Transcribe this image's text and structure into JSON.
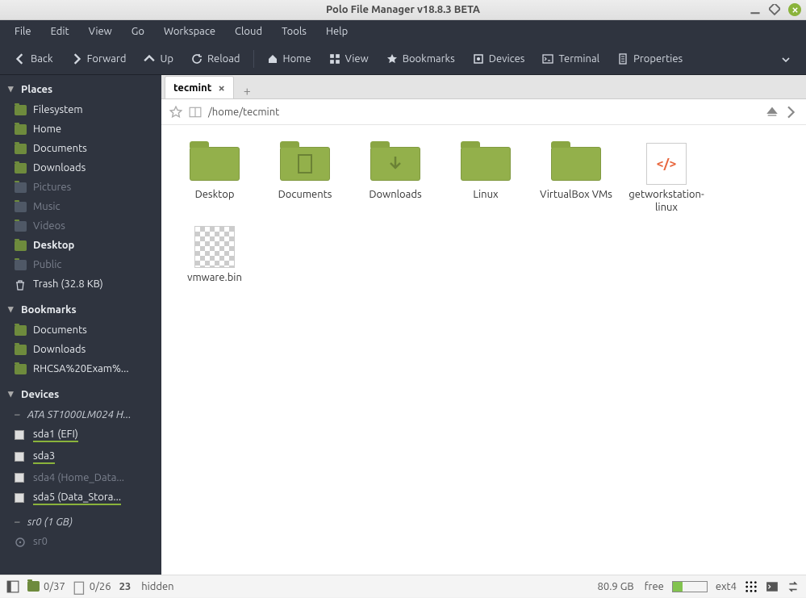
{
  "window": {
    "title": "Polo File Manager v18.8.3 BETA"
  },
  "menubar": [
    "File",
    "Edit",
    "View",
    "Go",
    "Workspace",
    "Cloud",
    "Tools",
    "Help"
  ],
  "toolbar": {
    "back": "Back",
    "forward": "Forward",
    "up": "Up",
    "reload": "Reload",
    "home": "Home",
    "view": "View",
    "bookmarks": "Bookmarks",
    "devices": "Devices",
    "terminal": "Terminal",
    "properties": "Properties"
  },
  "sidebar": {
    "places_header": "Places",
    "places": [
      {
        "label": "Filesystem",
        "bright": true
      },
      {
        "label": "Home",
        "bright": true
      },
      {
        "label": "Documents",
        "bright": true
      },
      {
        "label": "Downloads",
        "bright": true
      },
      {
        "label": "Pictures",
        "dim": true
      },
      {
        "label": "Music",
        "dim": true
      },
      {
        "label": "Videos",
        "dim": true
      },
      {
        "label": "Desktop",
        "bright": true,
        "bold": true
      },
      {
        "label": "Public",
        "dim": true
      }
    ],
    "trash": "Trash (32.8 KB)",
    "bookmarks_header": "Bookmarks",
    "bookmarks": [
      {
        "label": "Documents"
      },
      {
        "label": "Downloads"
      },
      {
        "label": "RHCSA%20Exam%..."
      }
    ],
    "devices_header": "Devices",
    "device_group": "ATA ST1000LM024 H...",
    "partitions": [
      {
        "label": "sda1 (EFI)",
        "underline": true
      },
      {
        "label": "sda3",
        "underline": true
      },
      {
        "label": "sda4 (Home_Data...",
        "dim": true
      },
      {
        "label": "sda5 (Data_Stora...",
        "underline": true
      }
    ],
    "cdrom_group": "sr0 (1 GB)",
    "cdrom": "sr0"
  },
  "tab": {
    "name": "tecmint"
  },
  "path": "/home/tecmint",
  "files": [
    {
      "name": "Desktop",
      "type": "folder"
    },
    {
      "name": "Documents",
      "type": "folder",
      "emblem": "doc"
    },
    {
      "name": "Downloads",
      "type": "folder",
      "emblem": "down"
    },
    {
      "name": "Linux",
      "type": "folder"
    },
    {
      "name": "VirtualBox VMs",
      "type": "folder"
    },
    {
      "name": "getworkstation-linux",
      "type": "code"
    },
    {
      "name": "vmware.bin",
      "type": "bin"
    }
  ],
  "statusbar": {
    "count1": "0/37",
    "count2": "0/26",
    "hidden": "23",
    "hidden_label": "hidden",
    "free": "80.9 GB",
    "free_label": "free",
    "fs": "ext4"
  }
}
